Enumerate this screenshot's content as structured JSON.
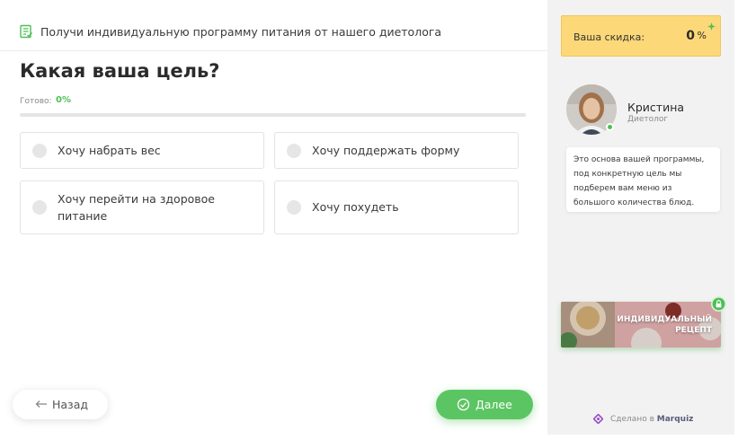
{
  "topbar": {
    "text": "Получи индивидуальную программу питания от нашего диетолога",
    "icon": "checklist-icon"
  },
  "quiz": {
    "question": "Какая ваша цель?",
    "progress_label": "Готово:",
    "progress_value": "0%",
    "progress_fraction": 0,
    "options": [
      {
        "label": "Хочу набрать вес"
      },
      {
        "label": "Хочу поддержать форму"
      },
      {
        "label": "Хочу перейти на здоровое питание"
      },
      {
        "label": "Хочу похудеть"
      }
    ]
  },
  "nav": {
    "back_label": "Назад",
    "next_label": "Далее"
  },
  "sidebar": {
    "discount_label": "Ваша скидка:",
    "discount_value": "0",
    "discount_unit": "%",
    "expert_name": "Кристина",
    "expert_role": "Диетолог",
    "message": "Это основа вашей программы, под конкретную цель мы подберем вам меню из большого количества блюд.",
    "bonus_line1": "ИНДИВИДУАЛЬНЫЙ",
    "bonus_line2": "РЕЦЕПТ",
    "made_in_prefix": "Сделано в",
    "made_in_brand": "Marquiz"
  },
  "colors": {
    "accent_green": "#5cc563",
    "discount_yellow": "#fcd878",
    "sidebar_bg": "#f2f2f2"
  }
}
